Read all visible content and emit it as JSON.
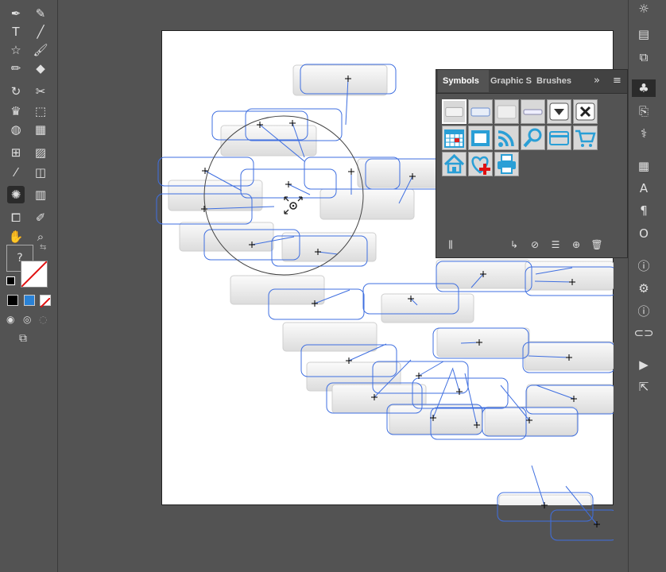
{
  "toolbar": {
    "tools": [
      {
        "name": "pen-tool",
        "glyph": "✒"
      },
      {
        "name": "curvature-tool",
        "glyph": "✎"
      },
      {
        "name": "type-tool",
        "glyph": "T"
      },
      {
        "name": "line-tool",
        "glyph": "╱"
      },
      {
        "name": "star-tool",
        "glyph": "☆"
      },
      {
        "name": "paintbrush-tool",
        "glyph": "🖌"
      },
      {
        "name": "pencil-tool",
        "glyph": "✏"
      },
      {
        "name": "eraser-tool",
        "glyph": "◆"
      },
      {
        "name": "rotate-tool",
        "glyph": "↻"
      },
      {
        "name": "scissors-tool",
        "glyph": "✂"
      },
      {
        "name": "width-tool",
        "glyph": "♛"
      },
      {
        "name": "free-transform-tool",
        "glyph": "⬚"
      },
      {
        "name": "shape-builder-tool",
        "glyph": "◍"
      },
      {
        "name": "perspective-grid-tool",
        "glyph": "▦"
      },
      {
        "name": "mesh-tool",
        "glyph": "⊞"
      },
      {
        "name": "gradient-tool",
        "glyph": "▨"
      },
      {
        "name": "eyedropper-tool",
        "glyph": "⁄"
      },
      {
        "name": "blend-tool",
        "glyph": "◫"
      },
      {
        "name": "symbol-sprayer-tool",
        "glyph": "✺",
        "active": true
      },
      {
        "name": "column-graph-tool",
        "glyph": "▥"
      },
      {
        "name": "artboard-tool",
        "glyph": "⧠"
      },
      {
        "name": "slice-tool",
        "glyph": "✐"
      },
      {
        "name": "hand-tool",
        "glyph": "✋"
      },
      {
        "name": "zoom-tool",
        "glyph": "⌕"
      }
    ],
    "fill_unknown_label": "?"
  },
  "symbols_panel": {
    "tabs": [
      "Symbols",
      "Graphic S",
      "Brushes"
    ],
    "active_tab": "Symbols",
    "symbols": [
      "button-gray",
      "button-blue-bar",
      "button-light",
      "button-slider",
      "dropdown-arrow",
      "close-x",
      "calendar",
      "film-strip",
      "rss-feed",
      "magnifier",
      "credit-card",
      "shopping-cart",
      "home",
      "heart-plus",
      "printer"
    ]
  },
  "right_dock": {
    "icons": [
      "sun-icon",
      "align-icon",
      "pathfinder-icon",
      "symbols-icon",
      "export-icon",
      "puppet-icon",
      "layers-icon",
      "char-icon",
      "para-icon",
      "opentype-icon",
      "info-icon",
      "settings-icon",
      "document-info-icon",
      "links-icon",
      "play-icon",
      "export-arrow-icon"
    ]
  },
  "colors": {
    "ui_bg": "#535353",
    "selection_blue": "#3f6fe0",
    "accent_blue": "#2a9fd6"
  }
}
